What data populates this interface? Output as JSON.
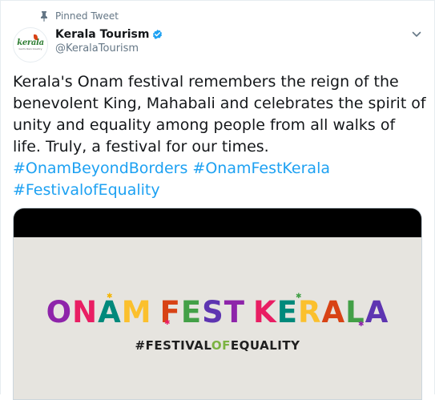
{
  "pinned": {
    "label": "Pinned Tweet",
    "icon": "pin-icon"
  },
  "author": {
    "display_name": "Kerala Tourism",
    "handle": "@KeralaTourism",
    "verified_icon": "verified-badge-icon",
    "avatar_word": "kerala",
    "avatar_tag": "God's Own Country"
  },
  "menu_icon": "chevron-down-icon",
  "tweet": {
    "text": "Kerala's Onam festival remembers the reign of the benevolent King, Mahabali and celebrates the spirit of unity and equality among people from all walks of life. Truly, a festival for our times.",
    "hashtags": [
      "#OnamBeyondBorders",
      "#OnamFestKerala",
      "#FestivalofEquality"
    ]
  },
  "media": {
    "title": "ONAM FEST KERALA",
    "subtitle_before": "#FESTIVAL",
    "subtitle_mid": "OF",
    "subtitle_after": "EQUALITY"
  },
  "colors": {
    "hashtag": "#1da1f2",
    "verified": "#1da1f2",
    "muted": "#657786",
    "title_palette": [
      "#8e24aa",
      "#e91e63",
      "#00897b",
      "#fbc02d",
      "#d84315",
      "#43a047",
      "#5e35b1"
    ]
  }
}
